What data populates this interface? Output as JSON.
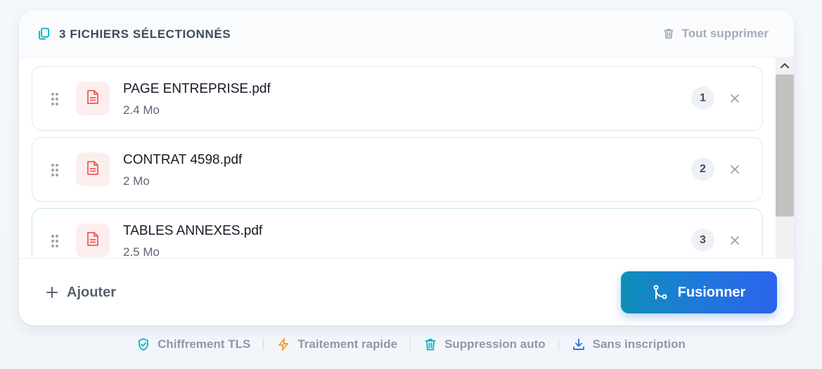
{
  "header": {
    "title": "3 FICHIERS SÉLECTIONNÉS",
    "clear_all_label": "Tout supprimer"
  },
  "files": [
    {
      "name": "PAGE ENTREPRISE.pdf",
      "size": "2.4 Mo",
      "order": "1"
    },
    {
      "name": "CONTRAT 4598.pdf",
      "size": "2 Mo",
      "order": "2"
    },
    {
      "name": "TABLES ANNEXES.pdf",
      "size": "2.5 Mo",
      "order": "3"
    }
  ],
  "footer": {
    "add_label": "Ajouter",
    "merge_label": "Fusionner"
  },
  "features": [
    {
      "label": "Chiffrement TLS",
      "icon": "shield-check-icon",
      "color": "#14b8c8"
    },
    {
      "label": "Traitement rapide",
      "icon": "lightning-icon",
      "color": "#f2a23a"
    },
    {
      "label": "Suppression auto",
      "icon": "trash-icon",
      "color": "#14b8c8"
    },
    {
      "label": "Sans inscription",
      "icon": "download-icon",
      "color": "#2b7be0"
    }
  ],
  "colors": {
    "accent_teal": "#14b8c8",
    "merge_gradient_start": "#0e8fb8",
    "merge_gradient_end": "#2c63eb",
    "pdf_icon": "#ef5b5b"
  }
}
